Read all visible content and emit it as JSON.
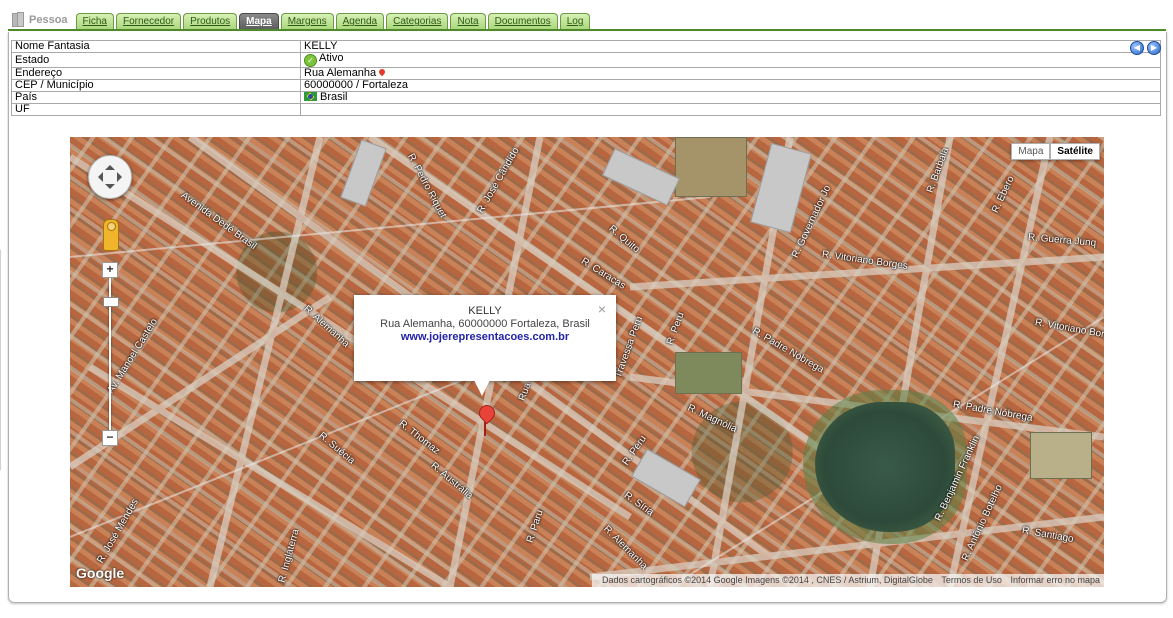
{
  "app": {
    "label": "Pessoa"
  },
  "tabs": [
    {
      "label": "Ficha",
      "active": false
    },
    {
      "label": "Fornecedor",
      "active": false
    },
    {
      "label": "Produtos",
      "active": false
    },
    {
      "label": "Mapa",
      "active": true
    },
    {
      "label": "Margens",
      "active": false
    },
    {
      "label": "Agenda",
      "active": false
    },
    {
      "label": "Categorias",
      "active": false
    },
    {
      "label": "Nota",
      "active": false
    },
    {
      "label": "Documentos",
      "active": false
    },
    {
      "label": "Log",
      "active": false
    }
  ],
  "info": {
    "rows": [
      {
        "label": "Nome Fantasia",
        "value": "KELLY"
      },
      {
        "label": "Estado",
        "value": "Ativo"
      },
      {
        "label": "Endereço",
        "value": "Rua Alemanha"
      },
      {
        "label": "CEP / Município",
        "value": "60000000 / Fortaleza"
      },
      {
        "label": "País",
        "value": "Brasil"
      },
      {
        "label": "UF",
        "value": ""
      }
    ]
  },
  "map": {
    "type_buttons": {
      "map": "Mapa",
      "satellite": "Satélite"
    },
    "selected_type": "Satélite",
    "logo": "Google",
    "attribution": {
      "data": "Dados cartográficos ©2014 Google Imagens ©2014 , CNES / Astrium, DigitalGlobe",
      "terms": "Termos de Uso",
      "report": "Informar erro no mapa"
    },
    "infowindow": {
      "title": "KELLY",
      "address": "Rua Alemanha, 60000000 Fortaleza, Brasil",
      "link": "www.jojerepresentacoes.com.br",
      "close": "×"
    },
    "street_labels": [
      "Avenida Dedé Brasil",
      "R. Pedro Riquet",
      "R. José Cândido",
      "R. Quito",
      "R. Governador Jo",
      "R. Barbala",
      "R. Ebero",
      "R. Guerra Junq",
      "R. Vitoriano Borges",
      "R. Caracas",
      "R. Peru",
      "R. Padre Nóbrega",
      "R. Vitoriano Bor",
      "R. Magnólia",
      "R. Padre Nóbrega",
      "R. Alemanha",
      "Av. Manoel Castelo",
      "R. Thomaz",
      "R. Suécia",
      "R. Austrália",
      "R. Peru",
      "R. Síria",
      "R. Paru",
      "R. Alemanha",
      "R. José Mendes",
      "R. Benjamin Franklin",
      "R. Antônio Botelho",
      "R. Santiago",
      "Travessa Peru",
      "Rua Etiópia",
      "R. Inglaterra"
    ]
  }
}
